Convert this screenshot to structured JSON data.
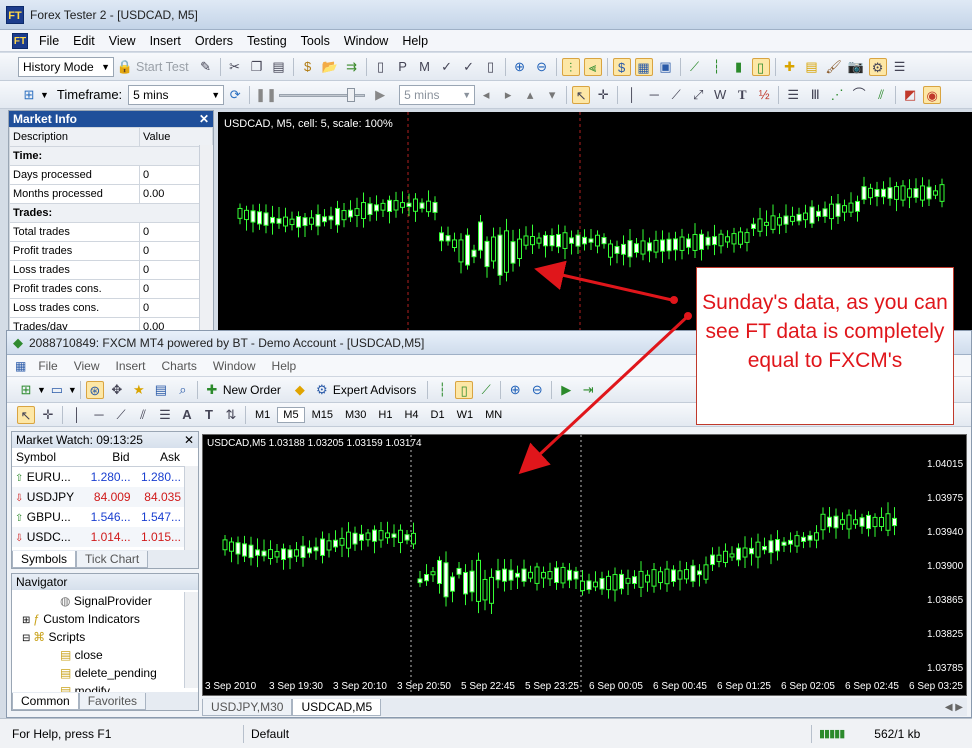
{
  "ft": {
    "title": "Forex Tester 2 - [USDCAD, M5]",
    "menu": [
      "File",
      "Edit",
      "View",
      "Insert",
      "Orders",
      "Testing",
      "Tools",
      "Window",
      "Help"
    ],
    "mode_value": "History Mode",
    "start_test": "Start Test",
    "timeframe_label": "Timeframe:",
    "timeframe_value": "5 mins",
    "speed_value": "5 mins",
    "market_info": {
      "title": "Market Info",
      "col_desc": "Description",
      "col_value": "Value",
      "rows": [
        {
          "group": "Time:"
        },
        {
          "label": "Days processed",
          "value": "0"
        },
        {
          "label": "Months processed",
          "value": "0.00"
        },
        {
          "group": "Trades:"
        },
        {
          "label": "Total trades",
          "value": "0"
        },
        {
          "label": "Profit trades",
          "value": "0"
        },
        {
          "label": "Loss trades",
          "value": "0"
        },
        {
          "label": "Profit trades cons.",
          "value": "0"
        },
        {
          "label": "Loss trades cons.",
          "value": "0"
        },
        {
          "label": "Trades/day",
          "value": "0.00"
        }
      ]
    },
    "chart_label": "USDCAD, M5, cell: 5, scale: 100%"
  },
  "callout": {
    "text": "Sunday's data, as you can see FT data is completely equal to FXCM's"
  },
  "mt4": {
    "title": "2088710849: FXCM MT4 powered by BT - Demo Account - [USDCAD,M5]",
    "menu": [
      "File",
      "View",
      "Insert",
      "Charts",
      "Window",
      "Help"
    ],
    "new_order": "New Order",
    "expert_advisors": "Expert Advisors",
    "timeframes": [
      "M1",
      "M5",
      "M15",
      "M30",
      "H1",
      "H4",
      "D1",
      "W1",
      "MN"
    ],
    "market_watch": {
      "title": "Market Watch: 09:13:25",
      "headers": [
        "Symbol",
        "Bid",
        "Ask"
      ],
      "rows": [
        {
          "symbol": "EURU...",
          "bid": "1.280...",
          "ask": "1.280...",
          "color": "#1a3fd0"
        },
        {
          "symbol": "USDJPY",
          "bid": "84.009",
          "ask": "84.035",
          "color": "#d01a1a"
        },
        {
          "symbol": "GBPU...",
          "bid": "1.546...",
          "ask": "1.547...",
          "color": "#1a3fd0"
        },
        {
          "symbol": "USDC...",
          "bid": "1.014...",
          "ask": "1.015...",
          "color": "#d01a1a"
        }
      ],
      "tabs": [
        "Symbols",
        "Tick Chart"
      ]
    },
    "navigator": {
      "title": "Navigator",
      "items": [
        "SignalProvider",
        "Custom Indicators",
        "Scripts",
        "close",
        "delete_pending",
        "modify"
      ],
      "tabs": [
        "Common",
        "Favorites"
      ]
    },
    "chart_header": "USDCAD,M5  1.03188 1.03205 1.03159 1.03174",
    "x_ticks": [
      "3 Sep 2010",
      "3 Sep 19:30",
      "3 Sep 20:10",
      "3 Sep 20:50",
      "5 Sep 22:45",
      "5 Sep 23:25",
      "6 Sep 00:05",
      "6 Sep 00:45",
      "6 Sep 01:25",
      "6 Sep 02:05",
      "6 Sep 02:45",
      "6 Sep 03:25"
    ],
    "y_ticks": [
      "1.04015",
      "1.03975",
      "1.03940",
      "1.03900",
      "1.03865",
      "1.03825",
      "1.03785"
    ],
    "chart_tabs": [
      "USDJPY,M30",
      "USDCAD,M5"
    ],
    "status": {
      "help": "For Help, press F1",
      "profile": "Default",
      "traffic": "562/1 kb"
    }
  }
}
